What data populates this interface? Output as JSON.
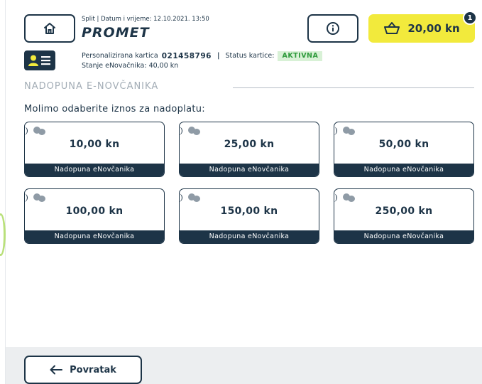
{
  "header": {
    "info_line": "Split | Datum i vrijeme: 12.10.2021. 13:50",
    "logo_text": "PROMET",
    "cart_amount": "20,00 kn",
    "cart_count": "1",
    "icons": {
      "home": "home-icon",
      "info": "info-icon",
      "cart": "basket-icon"
    }
  },
  "card": {
    "type_label": "Personalizirana kartica",
    "number": "021458796",
    "separator": "|",
    "status_label": "Status kartice:",
    "status_value": "AKTIVNA",
    "balance_line": "Stanje eNovačnika: 40,00 kn",
    "icon": "user-card-icon"
  },
  "section": {
    "title": "NADOPUNA E-NOVČANIKA",
    "prompt": "Molimo odaberite iznos za nadoplatu:"
  },
  "tiles": [
    {
      "amount": "10,00 kn",
      "label": "Nadopuna eNovčanika"
    },
    {
      "amount": "25,00 kn",
      "label": "Nadopuna eNovčanika"
    },
    {
      "amount": "50,00 kn",
      "label": "Nadopuna eNovčanika"
    },
    {
      "amount": "100,00 kn",
      "label": "Nadopuna eNovčanika"
    },
    {
      "amount": "150,00 kn",
      "label": "Nadopuna eNovčanika"
    },
    {
      "amount": "250,00 kn",
      "label": "Nadopuna eNovčanika"
    }
  ],
  "footer": {
    "back_label": "Povratak",
    "icon": "arrow-left-icon"
  },
  "colors": {
    "primary": "#1d3447",
    "accent": "#f2ea3c",
    "status_bg": "#d8f1d6",
    "status_text": "#2e9a3c"
  }
}
